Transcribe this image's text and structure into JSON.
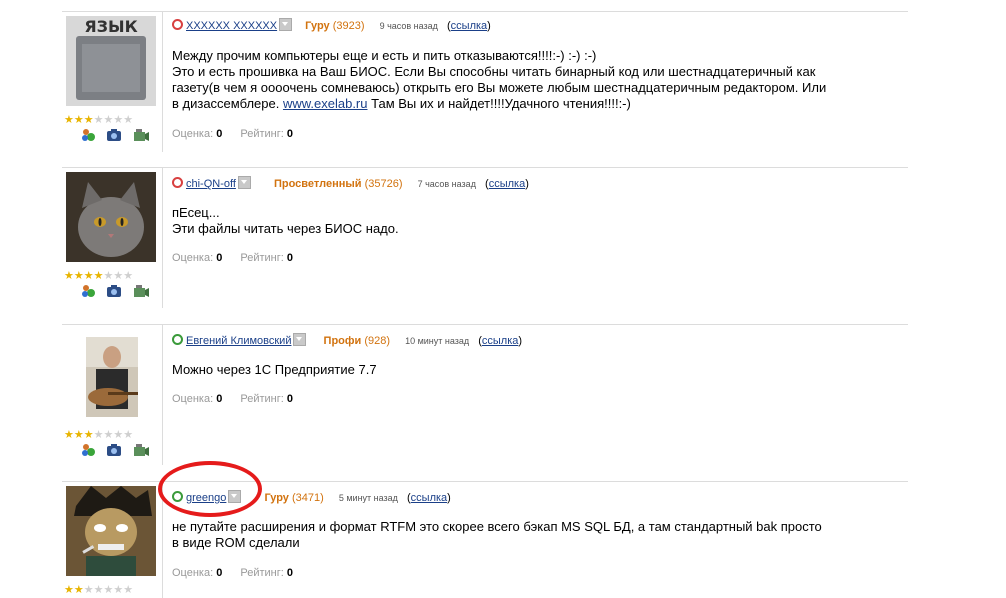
{
  "answers": [
    {
      "user": "XXXXXX XXXXXX",
      "rank": "Гуру",
      "points": "(3923)",
      "time": "9 часов назад",
      "link_open": "(",
      "link": "ссылка",
      "link_close": ")",
      "text_lines": [
        "Между прочим компьютеры еще и есть и пить отказываются!!!!:-) :-) :-)",
        "Это и есть прошивка на Ваш БИОС. Если Вы способны читать бинарный код или шестнадцатеричный как",
        "газету(в чем я оооочень сомневаюсь) открыть его Вы можете любым шестнадцатеричным редактором. Или"
      ],
      "last_line_pre": "в дизассемблере. ",
      "last_line_link": "www.exelab.ru",
      "last_line_post": " Там Вы их и найдет!!!!Удачного чтения!!!!:-)",
      "grade_label": "Оценка:",
      "grade": "0",
      "rating_label": "Рейтинг:",
      "rating": "0",
      "stars": 3,
      "avatar_caption": "ЯЗЫК"
    },
    {
      "user": "chi-QN-off",
      "rank": "Просветленный",
      "points": "(35726)",
      "time": "7 часов назад",
      "link_open": "(",
      "link": "ссылка",
      "link_close": ")",
      "text_lines": [
        "пЕсец...",
        "Эти файлы читать через БИОС надо."
      ],
      "grade_label": "Оценка:",
      "grade": "0",
      "rating_label": "Рейтинг:",
      "rating": "0",
      "stars": 4
    },
    {
      "user": "Евгений Климовский",
      "rank": "Профи",
      "points": "(928)",
      "time": "10 минут назад",
      "link_open": "(",
      "link": "ссылка",
      "link_close": ")",
      "text_lines": [
        "Можно через 1С Предприятие 7.7"
      ],
      "grade_label": "Оценка:",
      "grade": "0",
      "rating_label": "Рейтинг:",
      "rating": "0",
      "stars": 3
    },
    {
      "user": "greengo",
      "rank": "Гуру",
      "points": "(3471)",
      "time": "5 минут назад",
      "link_open": "(",
      "link": "ссылка",
      "link_close": ")",
      "text_lines": [
        "не путайте расширения и формат RTFM это скорее всего бэкап MS SQL БД, а там стандартный bak просто",
        "в виде ROM сделали"
      ],
      "grade_label": "Оценка:",
      "grade": "0",
      "rating_label": "Рейтинг:",
      "rating": "0",
      "stars": 2
    }
  ],
  "star_glyph": "★",
  "colors": {
    "link": "#1a3f88",
    "rank": "#d2730f",
    "highlight": "#e51b1b"
  }
}
